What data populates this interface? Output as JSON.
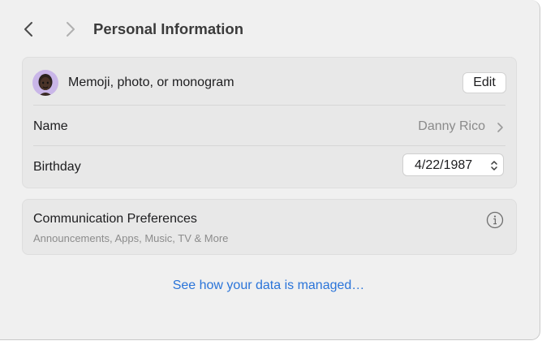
{
  "header": {
    "title": "Personal Information",
    "back_icon": "chevron-left-icon",
    "forward_icon": "chevron-right-icon"
  },
  "profile": {
    "picture_label": "Memoji, photo, or monogram",
    "edit_label": "Edit",
    "name_label": "Name",
    "name_value": "Danny Rico",
    "birthday_label": "Birthday",
    "birthday_value": "4/22/1987"
  },
  "communication": {
    "title": "Communication Preferences",
    "subtitle": "Announcements, Apps, Music, TV & More",
    "info_icon": "info-circle-icon"
  },
  "footer": {
    "link": "See how your data is managed…"
  },
  "colors": {
    "window_bg": "#f0f0f0",
    "card_bg": "#e8e8e8",
    "link": "#2a74d9",
    "secondary_text": "#8a8a8a",
    "avatar_bg": "#c9b6e8"
  }
}
